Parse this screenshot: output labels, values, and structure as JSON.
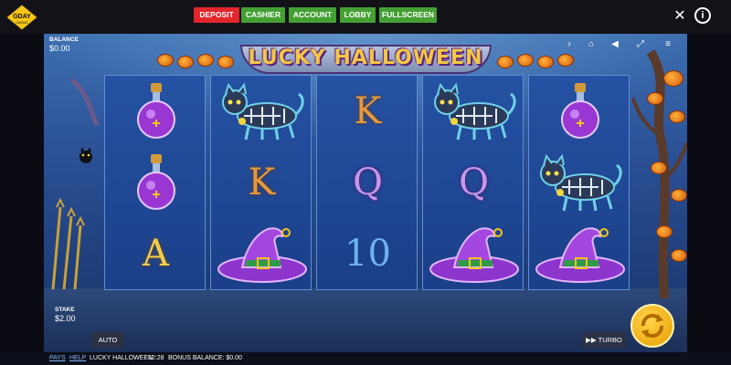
{
  "site": {
    "logo_text": "GDAY",
    "logo_sub": "CASINO",
    "nav": {
      "deposit": "DEPOSIT",
      "cashier": "CASHIER",
      "account": "ACCOUNT",
      "lobby": "LOBBY",
      "fullscreen": "FULLSCREEN"
    },
    "colors": {
      "deposit": "#e3262b",
      "nav_green": "#43a033"
    }
  },
  "game": {
    "title": "LUCKY HALLOWEEN",
    "balance_label": "BALANCE",
    "balance_value": "$0.00",
    "stake_label": "STAKE",
    "stake_value": "$2.00",
    "auto_label": "AUTO",
    "turbo_label": "TURBO",
    "reels": [
      [
        "potion",
        "potion",
        "A"
      ],
      [
        "cat",
        "K",
        "witch-hat"
      ],
      [
        "K",
        "Q",
        "10"
      ],
      [
        "cat",
        "Q",
        "witch-hat"
      ],
      [
        "potion",
        "cat",
        "witch-hat"
      ]
    ]
  },
  "footer": {
    "pays": "PAYS",
    "help": "HELP",
    "game_name": "LUCKY HALLOWEEN",
    "time": "12:28",
    "bonus_balance": "BONUS BALANCE: $0.00"
  }
}
